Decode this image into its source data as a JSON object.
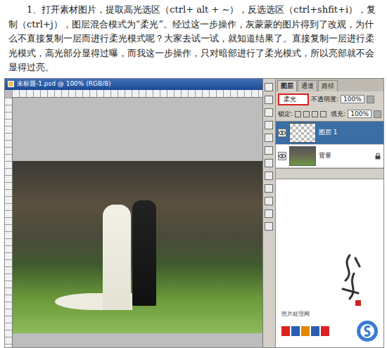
{
  "article": {
    "paragraph": "1、打开素材图片，提取高光选区（ctrl+ alt + ~），反选选区（ctrl+shfit+i），复制（ctrl+j），图层混合模式为“柔光”。经过这一步操作，灰蒙蒙的图片得到了改观，为什么不直接复制一层而进行柔光模式呢？大家去试一试，就知道结果了。直接复制一层进行柔光模式，高光部分显得过曝，而我这一步操作，只对暗部进行了柔光模式，所以亮部就不会显得过亮。"
  },
  "document_window": {
    "title": "未标题-1.psd @ 100% (RGB/8)"
  },
  "layers_panel": {
    "tabs": [
      {
        "label": "图层",
        "selected": true
      },
      {
        "label": "通道",
        "selected": false
      },
      {
        "label": "路径",
        "selected": false
      }
    ],
    "blend_mode": "柔光",
    "opacity_label": "不透明度:",
    "opacity": "100%",
    "lock_label": "锁定:",
    "fill_label": "填充:",
    "fill": "100%",
    "layers": [
      {
        "name": "图层 1",
        "selected": true,
        "locked": false
      },
      {
        "name": "背景",
        "selected": false,
        "locked": true
      }
    ]
  },
  "watermark": {
    "site": "照片处理网"
  }
}
